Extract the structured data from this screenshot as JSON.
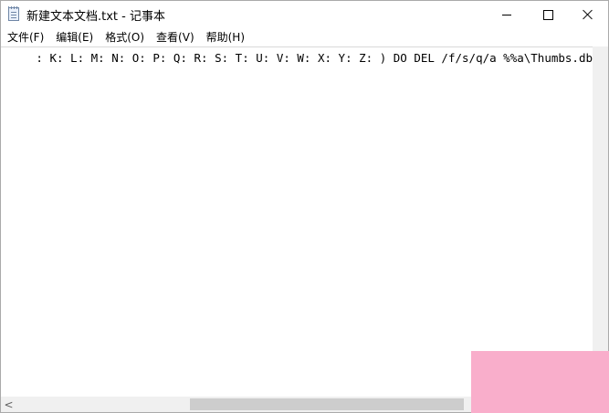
{
  "window": {
    "title": "新建文本文档.txt - 记事本",
    "icon": "notepad-icon"
  },
  "controls": {
    "minimize_icon": "minimize-icon",
    "maximize_icon": "maximize-icon",
    "close_icon": "close-icon"
  },
  "menu": {
    "items": [
      {
        "label": "文件(F)"
      },
      {
        "label": "编辑(E)"
      },
      {
        "label": "格式(O)"
      },
      {
        "label": "查看(V)"
      },
      {
        "label": "帮助(H)"
      }
    ]
  },
  "editor": {
    "visible_line": ": K: L: M: N: O: P: Q: R: S: T: U: V: W: X: Y: Z: ) DO DEL /f/s/q/a %%a\\Thumbs.db"
  },
  "scrollbar": {
    "left_arrow": "<"
  },
  "colors": {
    "watermark": "#f9aecb",
    "scrollbar_track": "#f0f0f0",
    "scrollbar_thumb": "#cdcdcd"
  }
}
